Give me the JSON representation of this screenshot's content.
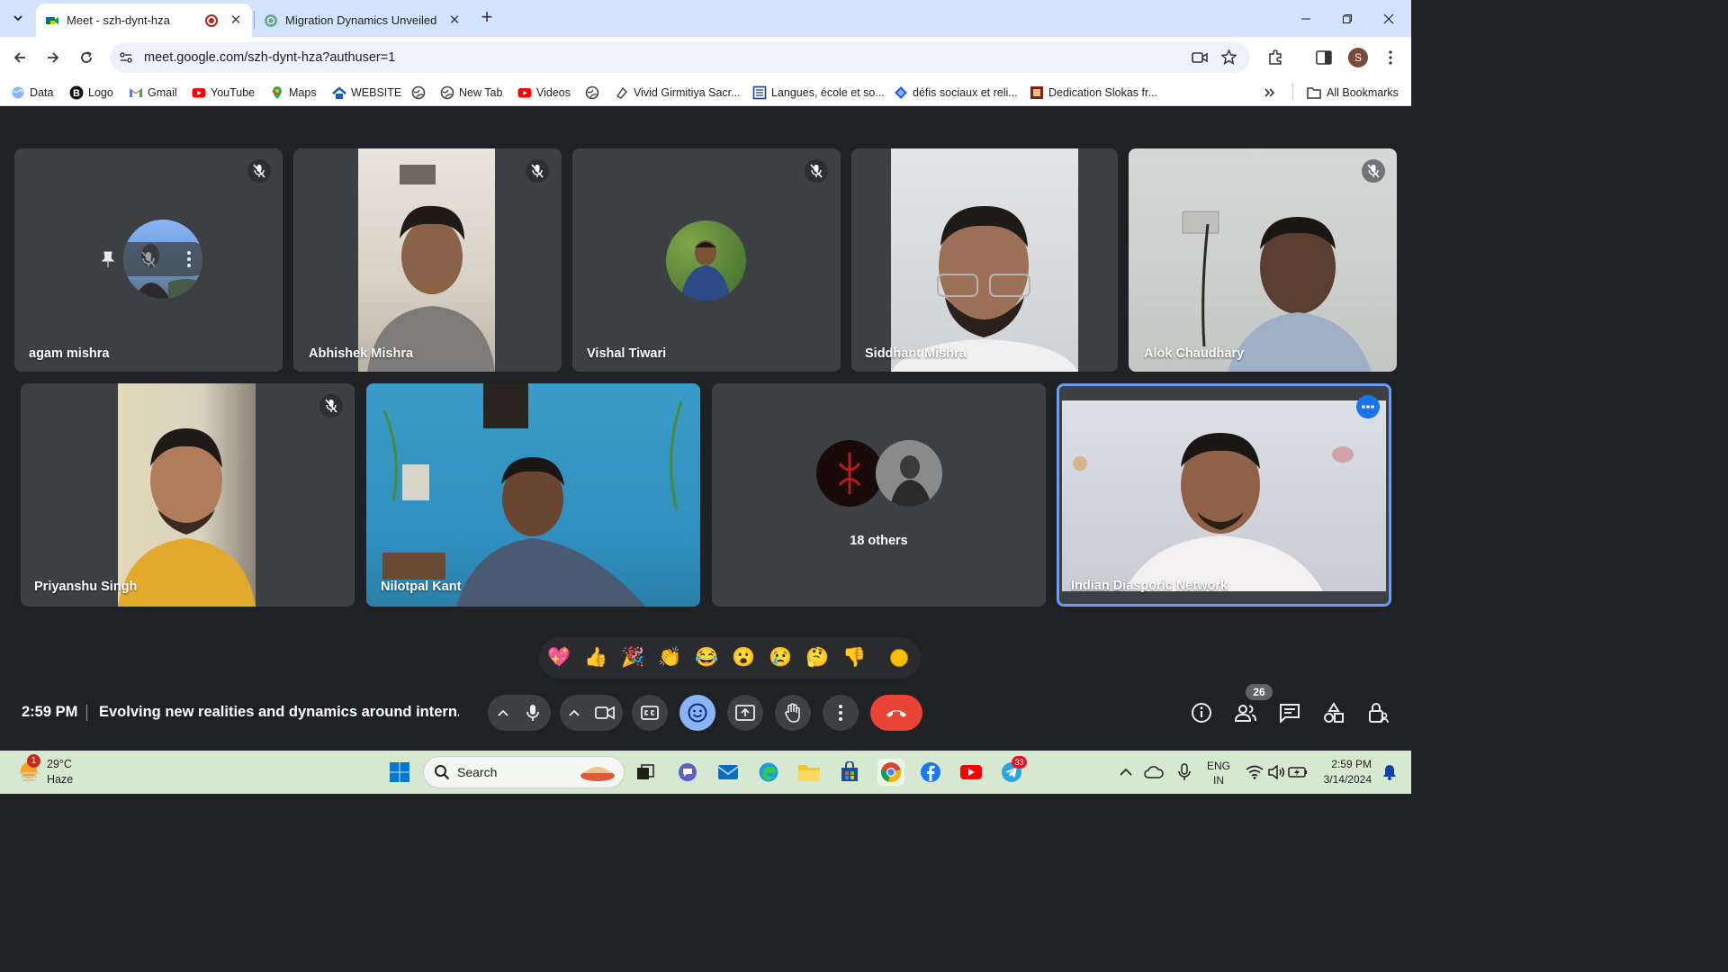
{
  "browser": {
    "tabs": [
      {
        "title": "Meet - szh-dynt-hza",
        "active": true
      },
      {
        "title": "Migration Dynamics Unveiled",
        "active": false
      }
    ],
    "url": "meet.google.com/szh-dynt-hza?authuser=1",
    "profile_initial": "S",
    "bookmarks": [
      {
        "label": "Data",
        "icon": "globe-icon"
      },
      {
        "label": "Logo",
        "icon": "b-logo-icon"
      },
      {
        "label": "Gmail",
        "icon": "gmail-icon"
      },
      {
        "label": "YouTube",
        "icon": "youtube-icon"
      },
      {
        "label": "Maps",
        "icon": "maps-icon"
      },
      {
        "label": "WEBSITE",
        "icon": "website-icon"
      },
      {
        "label": "",
        "icon": "globe-icon"
      },
      {
        "label": "New Tab",
        "icon": "globe-icon"
      },
      {
        "label": "Videos",
        "icon": "youtube-icon"
      },
      {
        "label": "",
        "icon": "globe-icon"
      },
      {
        "label": "Vivid Girmitiya Sacr...",
        "icon": "page-icon"
      },
      {
        "label": "Langues, école et so...",
        "icon": "page-icon"
      },
      {
        "label": "défis sociaux et reli...",
        "icon": "page-icon"
      },
      {
        "label": "Dedication Slokas fr...",
        "icon": "page-icon"
      }
    ],
    "all_bookmarks_label": "All Bookmarks"
  },
  "meet": {
    "participants_row1": [
      {
        "name": "agam mishra",
        "muted": true
      },
      {
        "name": "Abhishek Mishra",
        "muted": true
      },
      {
        "name": "Vishal Tiwari",
        "muted": true
      },
      {
        "name": "Siddhant Mishra",
        "muted": false
      },
      {
        "name": "Alok Chaudhary",
        "muted": true
      }
    ],
    "participants_row2": [
      {
        "name": "Priyanshu Singh",
        "muted": true
      },
      {
        "name": "Nilotpal Kant",
        "muted": false
      },
      {
        "name": "18 others",
        "muted": false
      },
      {
        "name": "Indian Diasporic Network",
        "muted": false
      }
    ],
    "reactions": [
      "💖",
      "👍",
      "🎉",
      "👏",
      "😂",
      "😮",
      "😢",
      "🤔",
      "👎"
    ],
    "time": "2:59 PM",
    "meeting_title": "Evolving new realities and dynamics around intern...",
    "people_count": "26"
  },
  "taskbar": {
    "weather_temp": "29°C",
    "weather_desc": "Haze",
    "weather_badge": "1",
    "search_placeholder": "Search",
    "lang_top": "ENG",
    "lang_bottom": "IN",
    "clock_time": "2:59 PM",
    "clock_date": "3/14/2024",
    "telegram_badge": "33"
  },
  "colors": {
    "meet_bg": "#202124",
    "tile_bg": "#3c4043",
    "end_call": "#ea4335",
    "accent_blue": "#8ab4f8",
    "active_tile_border": "#669df6"
  }
}
